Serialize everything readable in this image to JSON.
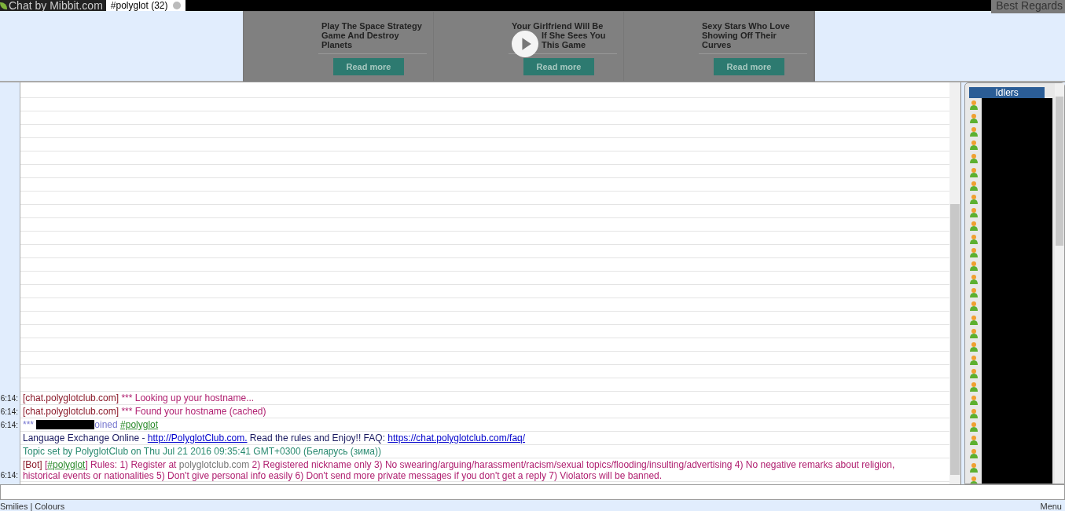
{
  "tabs": [
    {
      "label": "Chat by Mibbit.com",
      "kind": "brand",
      "selected": false
    },
    {
      "label": "#polyglot (32)",
      "kind": "channel",
      "selected": true,
      "closable": true
    }
  ],
  "corner_label": "Best Regards",
  "ads": [
    {
      "title": "Play The Space Strategy Game And Destroy Planets",
      "button": "Read more"
    },
    {
      "title_lines": [
        "Your Girlfriend Will Be",
        "If She Sees You",
        "This Game"
      ],
      "button": "Read more",
      "play_overlay": true
    },
    {
      "title": "Sexy Stars Who Love Showing Off Their Curves",
      "button": "Read more"
    }
  ],
  "messages": [
    {
      "time": "6:14:",
      "segments": [
        {
          "kind": "server",
          "text": "[chat.polyglotclub.com]"
        },
        {
          "kind": "notice",
          "text": " *** Looking up your hostname..."
        }
      ]
    },
    {
      "time": "6:14:",
      "segments": [
        {
          "kind": "server",
          "text": "[chat.polyglotclub.com]"
        },
        {
          "kind": "notice",
          "text": " *** Found your hostname (cached)"
        }
      ]
    },
    {
      "time": "6:14:",
      "segments": [
        {
          "kind": "join",
          "text": "*** "
        },
        {
          "kind": "redacted"
        },
        {
          "kind": "join",
          "text": "oined "
        },
        {
          "kind": "channel",
          "text": "#polyglot"
        }
      ]
    },
    {
      "segments": [
        {
          "kind": "plain",
          "text": "Language Exchange Online - "
        },
        {
          "kind": "url",
          "text": "http://PolyglotClub.com."
        },
        {
          "kind": "plain",
          "text": " Read the rules and Enjoy!! FAQ: "
        },
        {
          "kind": "url",
          "text": "https://chat.polyglotclub.com/faq/"
        }
      ]
    },
    {
      "segments": [
        {
          "kind": "topic",
          "text": "Topic set by PolyglotClub on Thu Jul 21 2016 09:35:41 GMT+0300 (Беларусь (зима))"
        }
      ]
    },
    {
      "time": "6:14:",
      "segments": [
        {
          "kind": "server",
          "text": "[Bot]"
        },
        {
          "kind": "notice",
          "text": " ["
        },
        {
          "kind": "channel",
          "text": "#polyglot"
        },
        {
          "kind": "notice",
          "text": "] Rules: 1) Register at "
        },
        {
          "kind": "grey",
          "text": "polyglotclub.com"
        },
        {
          "kind": "notice",
          "text": " 2) Registered nickname only 3) No swearing/arguing/harassment/racism/sexual topics/flooding/insulting/advertising 4) No negative remarks about religion, historical events or nationalities 5) Don't give personal info easily 6) Don't send more private messages if you don't get a reply 7) Violators will be banned."
        }
      ]
    }
  ],
  "idlers": {
    "title": "Idlers",
    "users": [
      {
        "kind": "user"
      },
      {
        "kind": "user"
      },
      {
        "kind": "user"
      },
      {
        "kind": "user"
      },
      {
        "kind": "user"
      },
      {
        "kind": "user"
      },
      {
        "kind": "user"
      },
      {
        "kind": "user"
      },
      {
        "kind": "user"
      },
      {
        "kind": "user"
      },
      {
        "kind": "user"
      },
      {
        "kind": "user"
      },
      {
        "kind": "user"
      },
      {
        "kind": "user"
      },
      {
        "kind": "user"
      },
      {
        "kind": "user"
      },
      {
        "kind": "user"
      },
      {
        "kind": "user"
      },
      {
        "kind": "user"
      },
      {
        "kind": "user"
      },
      {
        "kind": "user"
      },
      {
        "kind": "user"
      },
      {
        "kind": "user"
      },
      {
        "kind": "user"
      },
      {
        "kind": "user"
      },
      {
        "kind": "user"
      },
      {
        "kind": "user"
      },
      {
        "kind": "user"
      },
      {
        "kind": "user"
      }
    ]
  },
  "bottom_links": [
    "Smilies",
    "Colours"
  ],
  "bottom_separator": "|",
  "menu": "Menu"
}
